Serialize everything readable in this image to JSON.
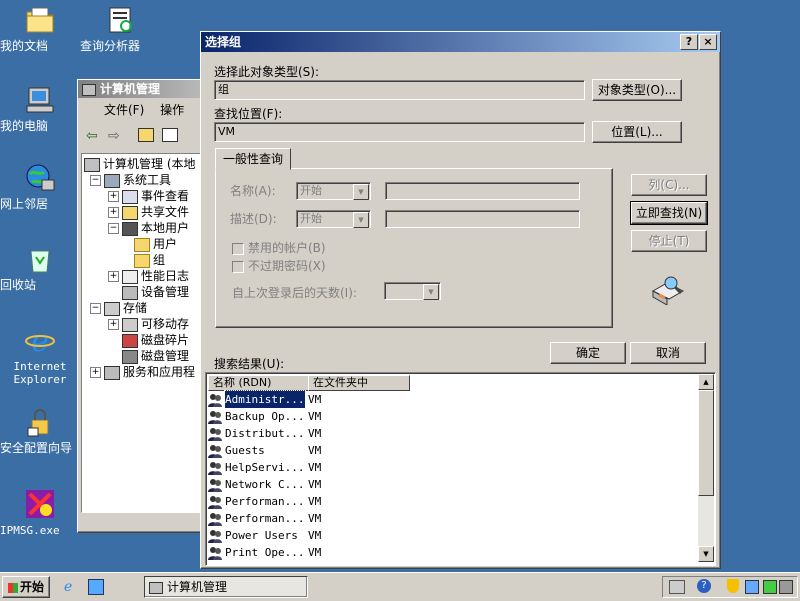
{
  "desktop": {
    "icons": [
      {
        "label": "我的文档"
      },
      {
        "label": "查询分析器"
      },
      {
        "label": "我的电脑"
      },
      {
        "label": "网上邻居"
      },
      {
        "label": "回收站"
      },
      {
        "label": "Internet Explorer"
      },
      {
        "label": "安全配置向导"
      },
      {
        "label": "IPMSG.exe"
      }
    ]
  },
  "mmc": {
    "title": "计算机管理",
    "menu": [
      "文件(F)",
      "操作"
    ],
    "tree": [
      {
        "label": "计算机管理 (本地"
      },
      {
        "label": "系统工具"
      },
      {
        "label": "事件查看"
      },
      {
        "label": "共享文件"
      },
      {
        "label": "本地用户"
      },
      {
        "label": "用户"
      },
      {
        "label": "组"
      },
      {
        "label": "性能日志"
      },
      {
        "label": "设备管理"
      },
      {
        "label": "存储"
      },
      {
        "label": "可移动存"
      },
      {
        "label": "磁盘碎片"
      },
      {
        "label": "磁盘管理"
      },
      {
        "label": "服务和应用程"
      }
    ]
  },
  "dialog": {
    "title": "选择组",
    "object_type_label": "选择此对象类型(S):",
    "object_type_value": "组",
    "object_type_button": "对象类型(O)...",
    "location_label": "查找位置(F):",
    "location_value": "VM",
    "location_button": "位置(L)...",
    "tab_label": "一般性查询",
    "name_label": "名称(A):",
    "name_op": "开始",
    "desc_label": "描述(D):",
    "desc_op": "开始",
    "disabled_accounts": "禁用的帐户(B)",
    "non_expiring": "不过期密码(X)",
    "days_since_logon": "自上次登录后的天数(I):",
    "columns_button": "列(C)...",
    "find_now_button": "立即查找(N)",
    "stop_button": "停止(T)",
    "ok_button": "确定",
    "cancel_button": "取消",
    "results_label": "搜索结果(U):",
    "results_headers": [
      "名称 (RDN)",
      "在文件夹中"
    ],
    "results": [
      {
        "name": "Administr...",
        "folder": "VM"
      },
      {
        "name": "Backup Op...",
        "folder": "VM"
      },
      {
        "name": "Distribut...",
        "folder": "VM"
      },
      {
        "name": "Guests",
        "folder": "VM"
      },
      {
        "name": "HelpServi...",
        "folder": "VM"
      },
      {
        "name": "Network C...",
        "folder": "VM"
      },
      {
        "name": "Performan...",
        "folder": "VM"
      },
      {
        "name": "Performan...",
        "folder": "VM"
      },
      {
        "name": "Power Users",
        "folder": "VM"
      },
      {
        "name": "Print Ope...",
        "folder": "VM"
      }
    ]
  },
  "taskbar": {
    "start_label": "开始",
    "task_label": "计算机管理"
  }
}
